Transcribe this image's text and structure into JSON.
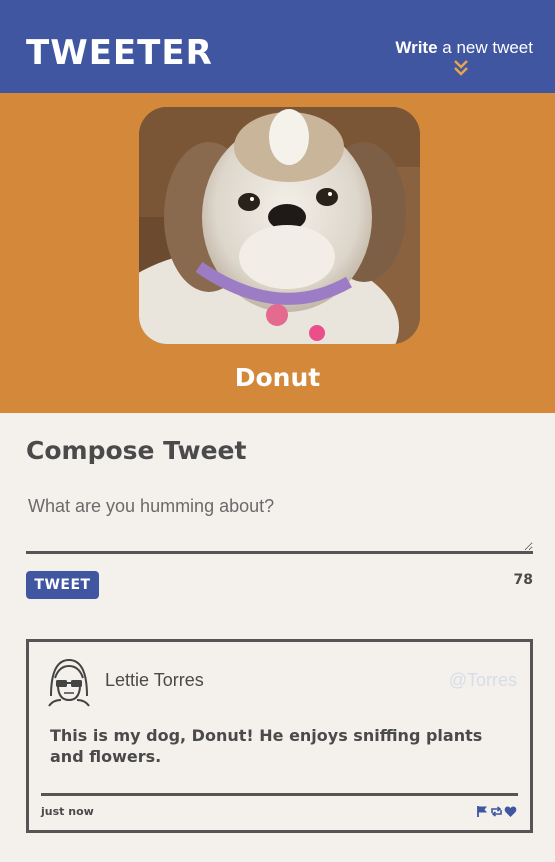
{
  "nav": {
    "brand": "TWEETER",
    "write_bold": "Write",
    "write_rest": " a new tweet",
    "chevron_icon": "double-chevron-down-icon",
    "accent": "#e8a54a",
    "bg": "#4056a1"
  },
  "header": {
    "bg": "#d4883a",
    "username": "Donut",
    "avatar_icon": "dog-photo"
  },
  "compose": {
    "title": "Compose Tweet",
    "placeholder": "What are you humming about?",
    "button_label": "TWEET",
    "counter": "78"
  },
  "tweets": [
    {
      "name": "Lettie Torres",
      "handle": "@Torres",
      "content": "This is my dog, Donut! He enjoys sniffing plants and flowers.",
      "time": "just now",
      "avatar_icon": "user-glasses-avatar-icon",
      "actions": [
        "flag-icon",
        "retweet-icon",
        "heart-icon"
      ]
    }
  ]
}
